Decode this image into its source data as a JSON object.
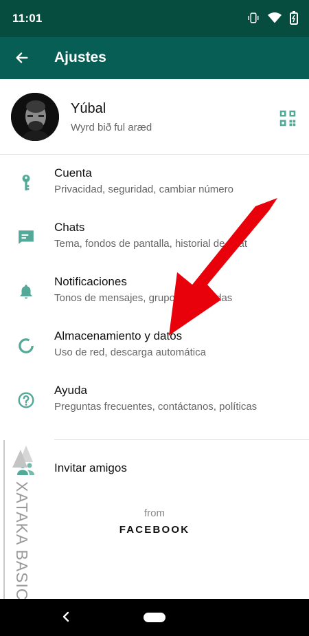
{
  "status_bar": {
    "time": "11:01"
  },
  "app_bar": {
    "title": "Ajustes"
  },
  "profile": {
    "name": "Yúbal",
    "status": "Wyrd bið ful aræd"
  },
  "menu": [
    {
      "title": "Cuenta",
      "subtitle": "Privacidad, seguridad, cambiar número",
      "icon": "key-icon"
    },
    {
      "title": "Chats",
      "subtitle": "Tema, fondos de pantalla, historial de chat",
      "icon": "chat-icon"
    },
    {
      "title": "Notificaciones",
      "subtitle": "Tonos de mensajes, grupos y llamadas",
      "icon": "bell-icon"
    },
    {
      "title": "Almacenamiento y datos",
      "subtitle": "Uso de red, descarga automática",
      "icon": "data-usage-icon"
    },
    {
      "title": "Ayuda",
      "subtitle": "Preguntas frecuentes, contáctanos, políticas",
      "icon": "help-icon"
    }
  ],
  "invite": {
    "label": "Invitar amigos",
    "icon": "people-icon"
  },
  "footer": {
    "from": "from",
    "brand": "FACEBOOK"
  },
  "watermark": {
    "text": "XATAKA BASICS"
  },
  "colors": {
    "header_dark": "#064d40",
    "header": "#075e54",
    "icon_teal": "#52a997",
    "arrow_red": "#e8000b"
  }
}
